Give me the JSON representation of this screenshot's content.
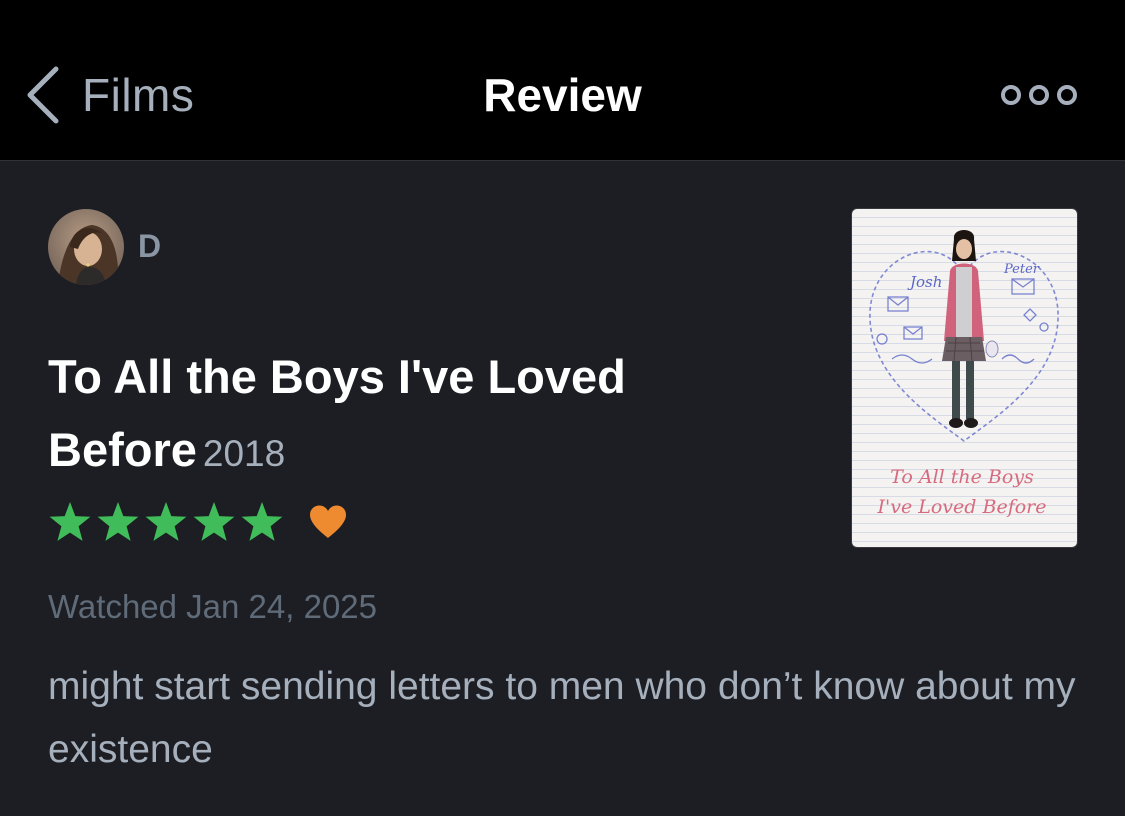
{
  "nav": {
    "back_label": "Films",
    "title": "Review",
    "back_icon": "chevron-left-icon",
    "more_icon": "more-dots-icon"
  },
  "review": {
    "username": "D",
    "film_title": "To All the Boys I've Loved Before",
    "film_year": "2018",
    "rating_stars": 5,
    "liked": true,
    "watched_label": "Watched Jan 24, 2025",
    "text": "might start sending letters to men who don’t know about my existence"
  },
  "poster": {
    "title_line1": "To All the Boys",
    "title_line2": "I've Loved Before",
    "doodle_name_left": "Josh",
    "doodle_name_right": "Peter"
  },
  "colors": {
    "nav_background": "#000000",
    "background": "#1c1e23",
    "star_green": "#40bc5a",
    "heart_orange": "#ee8a30",
    "text_primary": "#ffffff",
    "text_secondary": "#a6b0bd",
    "text_muted": "#5f6b78"
  }
}
